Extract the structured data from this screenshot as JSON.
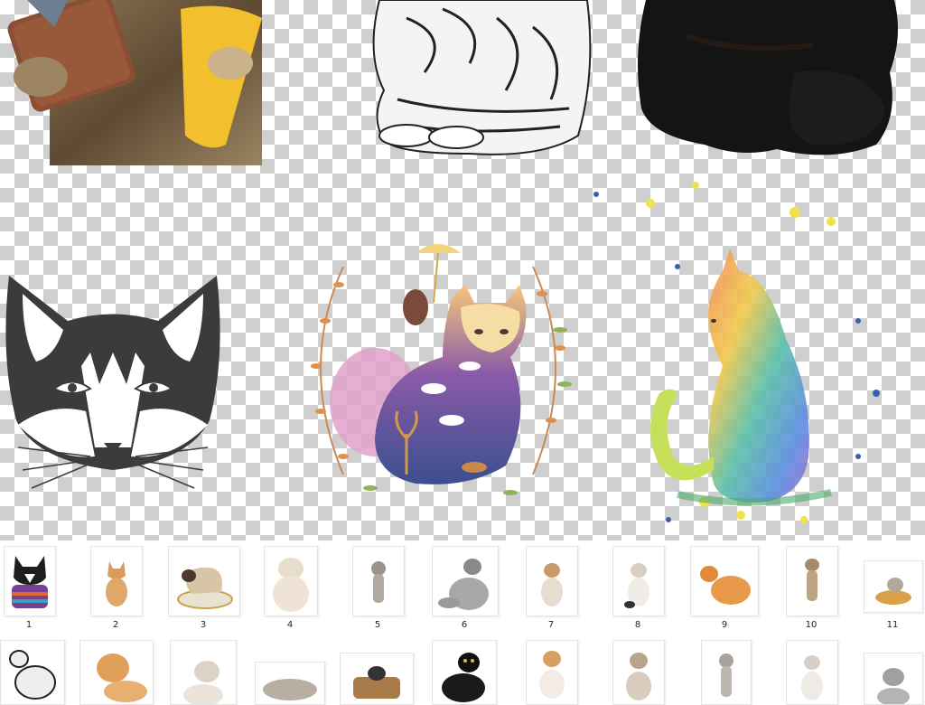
{
  "thumbnails": [
    {
      "number": "1",
      "icon": "cat-sweater-icon"
    },
    {
      "number": "2",
      "icon": "orange-kitten-icon"
    },
    {
      "number": "3",
      "icon": "siamese-cat-bowl-icon"
    },
    {
      "number": "4",
      "icon": "persian-cat-icon"
    },
    {
      "number": "5",
      "icon": "tabby-kitten-icon"
    },
    {
      "number": "6",
      "icon": "fluffy-gray-cat-icon"
    },
    {
      "number": "7",
      "icon": "calico-kitten-icon"
    },
    {
      "number": "8",
      "icon": "white-kitten-icon"
    },
    {
      "number": "9",
      "icon": "ginger-cat-icon"
    },
    {
      "number": "10",
      "icon": "standing-kitten-icon"
    },
    {
      "number": "11",
      "icon": "kitten-basket-icon"
    }
  ],
  "colors": {
    "checker_light": "#ffffff",
    "checker_dark": "#cfcfcf",
    "cat_face": "#3b3b3b",
    "watercolor_accent": "#f2c94c"
  }
}
